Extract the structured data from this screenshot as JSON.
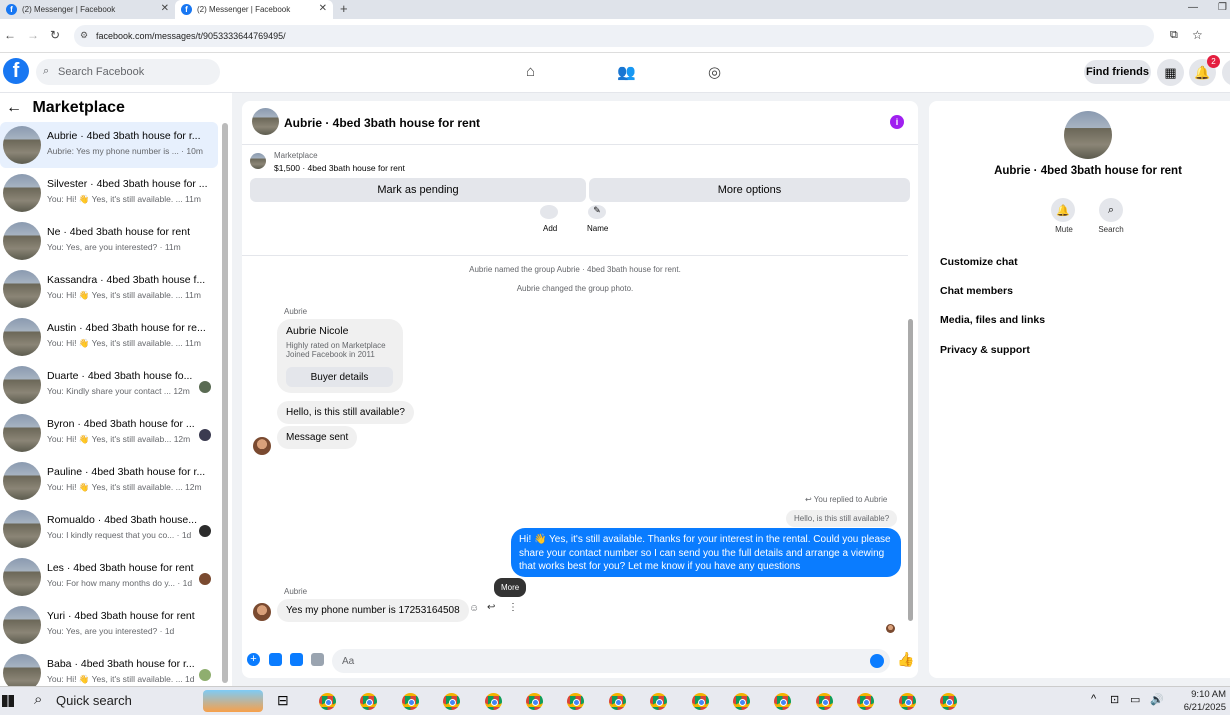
{
  "browser": {
    "tabs": [
      {
        "title": "(2) Messenger | Facebook"
      },
      {
        "title": "(2) Messenger | Facebook"
      }
    ],
    "new_tab": "+",
    "url": "facebook.com/messages/t/9053333644769495/"
  },
  "fb_header": {
    "logo": "f",
    "search_placeholder": "Search Facebook",
    "find_friends": "Find friends",
    "notification_count": "2"
  },
  "sidebar": {
    "title": "Marketplace",
    "conversations": [
      {
        "title": "Aubrie · 4bed 3bath house for r...",
        "preview": "Aubrie: Yes my phone number is ... · 10m"
      },
      {
        "title": "Silvester · 4bed 3bath house for ...",
        "preview": "You: Hi! 👋 Yes, it's still available. ... 11m"
      },
      {
        "title": "Ne · 4bed 3bath house for rent",
        "preview": "You: Yes, are you interested? · 11m"
      },
      {
        "title": "Kassandra · 4bed 3bath house f...",
        "preview": "You: Hi! 👋 Yes, it's still available. ... 11m"
      },
      {
        "title": "Austin · 4bed 3bath house for re...",
        "preview": "You: Hi! 👋 Yes, it's still available. ... 11m"
      },
      {
        "title": "Duarte · 4bed 3bath house fo...",
        "preview": "You: Kindly share your contact ... 12m"
      },
      {
        "title": "Byron · 4bed 3bath house for ...",
        "preview": "You: Hi! 👋 Yes, it's still availab... 12m"
      },
      {
        "title": "Pauline · 4bed 3bath house for r...",
        "preview": "You: Hi! 👋 Yes, it's still available. ... 12m"
      },
      {
        "title": "Romualdo · 4bed 3bath house...",
        "preview": "You: I kindly request that you co... · 1d"
      },
      {
        "title": "Les · 4bed 3bath house for rent",
        "preview": "You: For how many months do y... · 1d"
      },
      {
        "title": "Yuri · 4bed 3bath house for rent",
        "preview": "You: Yes, are you interested? · 1d"
      },
      {
        "title": "Baba · 4bed 3bath house for r...",
        "preview": "You: Hi! 👋 Yes, it's still available. ... 1d"
      }
    ]
  },
  "chat": {
    "title": "Aubrie · 4bed 3bath house for rent",
    "marketplace_label": "Marketplace",
    "listing": "$1,500 · 4bed 3bath house for rent",
    "mark_pending": "Mark as pending",
    "more_options": "More options",
    "add_label": "Add",
    "name_label": "Name",
    "sys_named": "Aubrie named the group Aubrie · 4bed 3bath house for rent.",
    "sys_photo": "Aubrie changed the group photo.",
    "sender_name_1": "Aubrie",
    "buyer_name": "Aubrie Nicole",
    "buyer_rating": "Highly rated on Marketplace",
    "buyer_joined": "Joined Facebook in 2011",
    "buyer_details": "Buyer details",
    "msg_available": "Hello, is this still available?",
    "msg_sent": "Message sent",
    "replied_to": "You replied to Aubrie",
    "quoted": "Hello, is this still available?",
    "outgoing": "Hi! 👋 Yes, it's still available. Thanks for your interest in the rental. Could you please share your contact number so I can send you the full details and arrange a viewing that works best for you? Let me know if you have any questions",
    "tooltip": "More",
    "sender_name_2": "Aubrie",
    "msg_phone": "Yes my phone number is 17253164508",
    "composer_placeholder": "Aa"
  },
  "details": {
    "title": "Aubrie · 4bed 3bath house for rent",
    "mute": "Mute",
    "search": "Search",
    "items": [
      "Customize chat",
      "Chat members",
      "Media, files and links",
      "Privacy & support"
    ]
  },
  "taskbar": {
    "quick_search": "Quick search",
    "time": "9:10 AM",
    "date": "6/21/2025"
  }
}
